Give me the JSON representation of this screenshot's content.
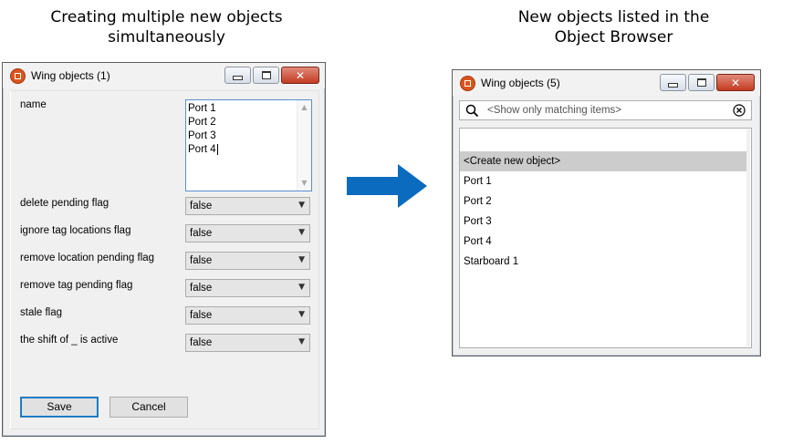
{
  "captions": {
    "left_line1": "Creating multiple new objects",
    "left_line2": "simultaneously",
    "right_line1": "New objects listed in the",
    "right_line2": "Object Browser"
  },
  "left_window": {
    "title": "Wing objects (1)",
    "fields": {
      "name_label": "name",
      "name_lines": [
        "Port 1",
        "Port 2",
        "Port 3",
        "Port 4"
      ],
      "rows": [
        {
          "label": "delete pending flag",
          "value": "false"
        },
        {
          "label": "ignore tag locations flag",
          "value": "false"
        },
        {
          "label": "remove location pending flag",
          "value": "false"
        },
        {
          "label": "remove tag pending flag",
          "value": "false"
        },
        {
          "label": "stale flag",
          "value": "false"
        },
        {
          "label": "the shift of _ is active",
          "value": "false"
        }
      ]
    },
    "save_label": "Save",
    "cancel_label": "Cancel"
  },
  "right_window": {
    "title": "Wing objects (5)",
    "search_placeholder": "<Show only matching items>",
    "items": [
      "<Create new object>",
      "Port 1",
      "Port 2",
      "Port 3",
      "Port 4",
      "Starboard 1"
    ]
  },
  "colors": {
    "arrow": "#0b6bbf",
    "selected_item": "#cccccc",
    "close_button": "#c43b22"
  },
  "icons": {
    "app": "app-icon",
    "search": "search-icon",
    "clear": "clear-icon",
    "arrow": "right-arrow-icon"
  }
}
